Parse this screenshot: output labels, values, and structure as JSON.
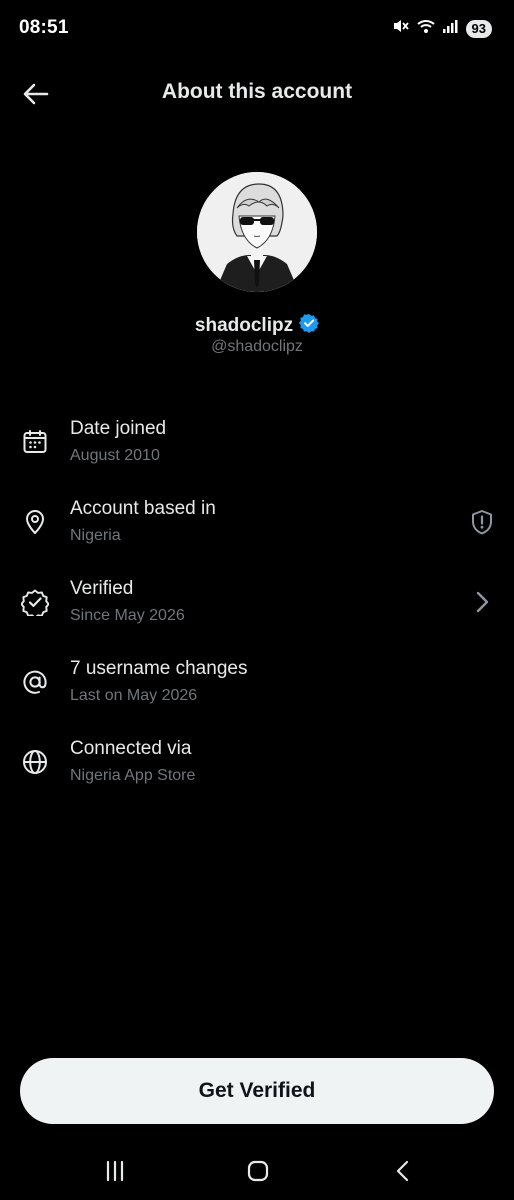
{
  "status_bar": {
    "time": "08:51",
    "battery": "93"
  },
  "header": {
    "title": "About this account"
  },
  "profile": {
    "display_name": "shadoclipz",
    "handle": "@shadoclipz",
    "verified_badge_color": "#1d9bf0"
  },
  "info_rows": [
    {
      "icon": "calendar-icon",
      "title": "Date joined",
      "subtitle": "August 2010"
    },
    {
      "icon": "location-pin-icon",
      "title": "Account based in",
      "subtitle": "Nigeria",
      "trailing": "shield-alert-icon"
    },
    {
      "icon": "verified-badge-outline-icon",
      "title": "Verified",
      "subtitle": "Since May 2026",
      "trailing": "chevron-right-icon"
    },
    {
      "icon": "at-sign-icon",
      "title": "7 username changes",
      "subtitle": "Last on May 2026"
    },
    {
      "icon": "globe-icon",
      "title": "Connected via",
      "subtitle": "Nigeria App Store"
    }
  ],
  "cta": {
    "label": "Get Verified"
  },
  "nav_bar": {
    "items": [
      "recent-apps-icon",
      "home-icon",
      "back-icon"
    ]
  }
}
